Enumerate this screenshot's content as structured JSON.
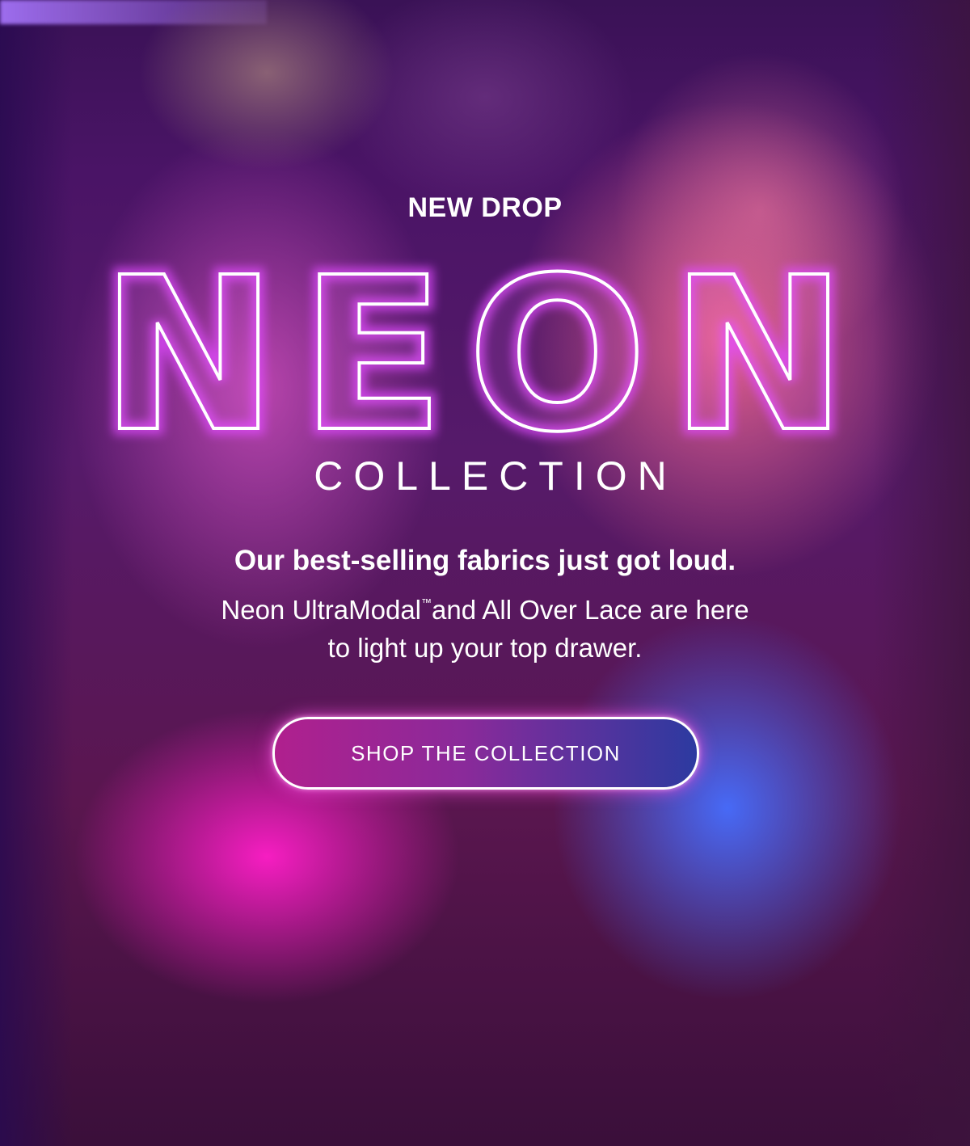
{
  "hero": {
    "kicker": "NEW DROP",
    "neon_word": "NEON",
    "collection_word": "COLLECTION",
    "headline": "Our best-selling fabrics just got loud.",
    "body_line1_pre": "Neon UltraModal",
    "body_line1_tm": "™",
    "body_line1_post": "and All Over Lace are here",
    "body_line2": "to light up your top drawer.",
    "cta_label": "SHOP THE COLLECTION"
  },
  "colors": {
    "neon_glow": "#e04bff",
    "cta_gradient_start": "#b0208e",
    "cta_gradient_end": "#2c3aa0",
    "text": "#ffffff"
  }
}
